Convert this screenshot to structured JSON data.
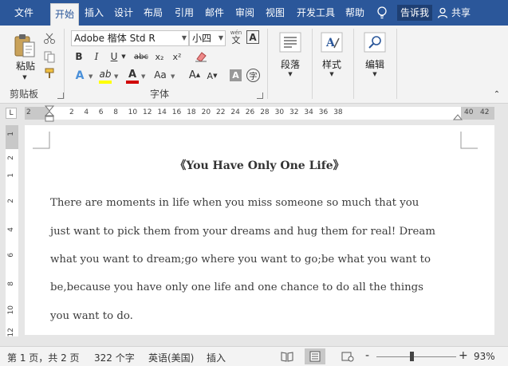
{
  "tabs": [
    "文件",
    "开始",
    "插入",
    "设计",
    "布局",
    "引用",
    "邮件",
    "审阅",
    "视图",
    "开发工具",
    "帮助"
  ],
  "active_tab": "开始",
  "tell_me": "告诉我",
  "share": "共享",
  "ribbon": {
    "clipboard": {
      "paste_label": "粘贴",
      "group_label": "剪贴板"
    },
    "font": {
      "font_name": "Adobe 楷体 Std R",
      "font_size": "小四",
      "wen_glyph": "wén",
      "wen_char": "文",
      "group_label": "字体",
      "bold": "B",
      "italic": "I",
      "underline": "U",
      "strike": "abc",
      "subscript": "x₂",
      "superscript": "x²",
      "change_case": "Aa",
      "grow": "A",
      "shrink": "A",
      "char_shade": "A",
      "enclose": "字"
    },
    "paragraph_label": "段落",
    "styles_label": "样式",
    "editing_label": "编辑"
  },
  "ruler": {
    "corner": "L",
    "numbers": [
      "2",
      "2",
      "4",
      "6",
      "8",
      "10",
      "12",
      "14",
      "16",
      "18",
      "20",
      "22",
      "24",
      "26",
      "28",
      "30",
      "32",
      "34",
      "36",
      "38",
      "40",
      "42"
    ],
    "vertical_numbers": [
      "1",
      "2",
      "1",
      "2",
      "4",
      "6",
      "8",
      "10",
      "12"
    ]
  },
  "document": {
    "title": "《You Have Only One Life》",
    "lines": [
      "There are moments in life when you miss someone so much that you",
      "just want to pick them from your dreams and hug them for real! Dream",
      "what you want to dream;go where you want to go;be what you want to",
      "be,because you have only one life and one chance to do all the things",
      "you want to do."
    ]
  },
  "status": {
    "page": "第 1 页，共 2 页",
    "words": "322 个字",
    "language": "英语(美国)",
    "mode": "插入",
    "zoom_minus": "-",
    "zoom_plus": "+",
    "zoom": "93%"
  },
  "colors": {
    "tab_bar": "#2b579a",
    "highlight": "#ffff00",
    "font_color": "#d00000",
    "ribbon_bg": "#f3f3f3"
  }
}
